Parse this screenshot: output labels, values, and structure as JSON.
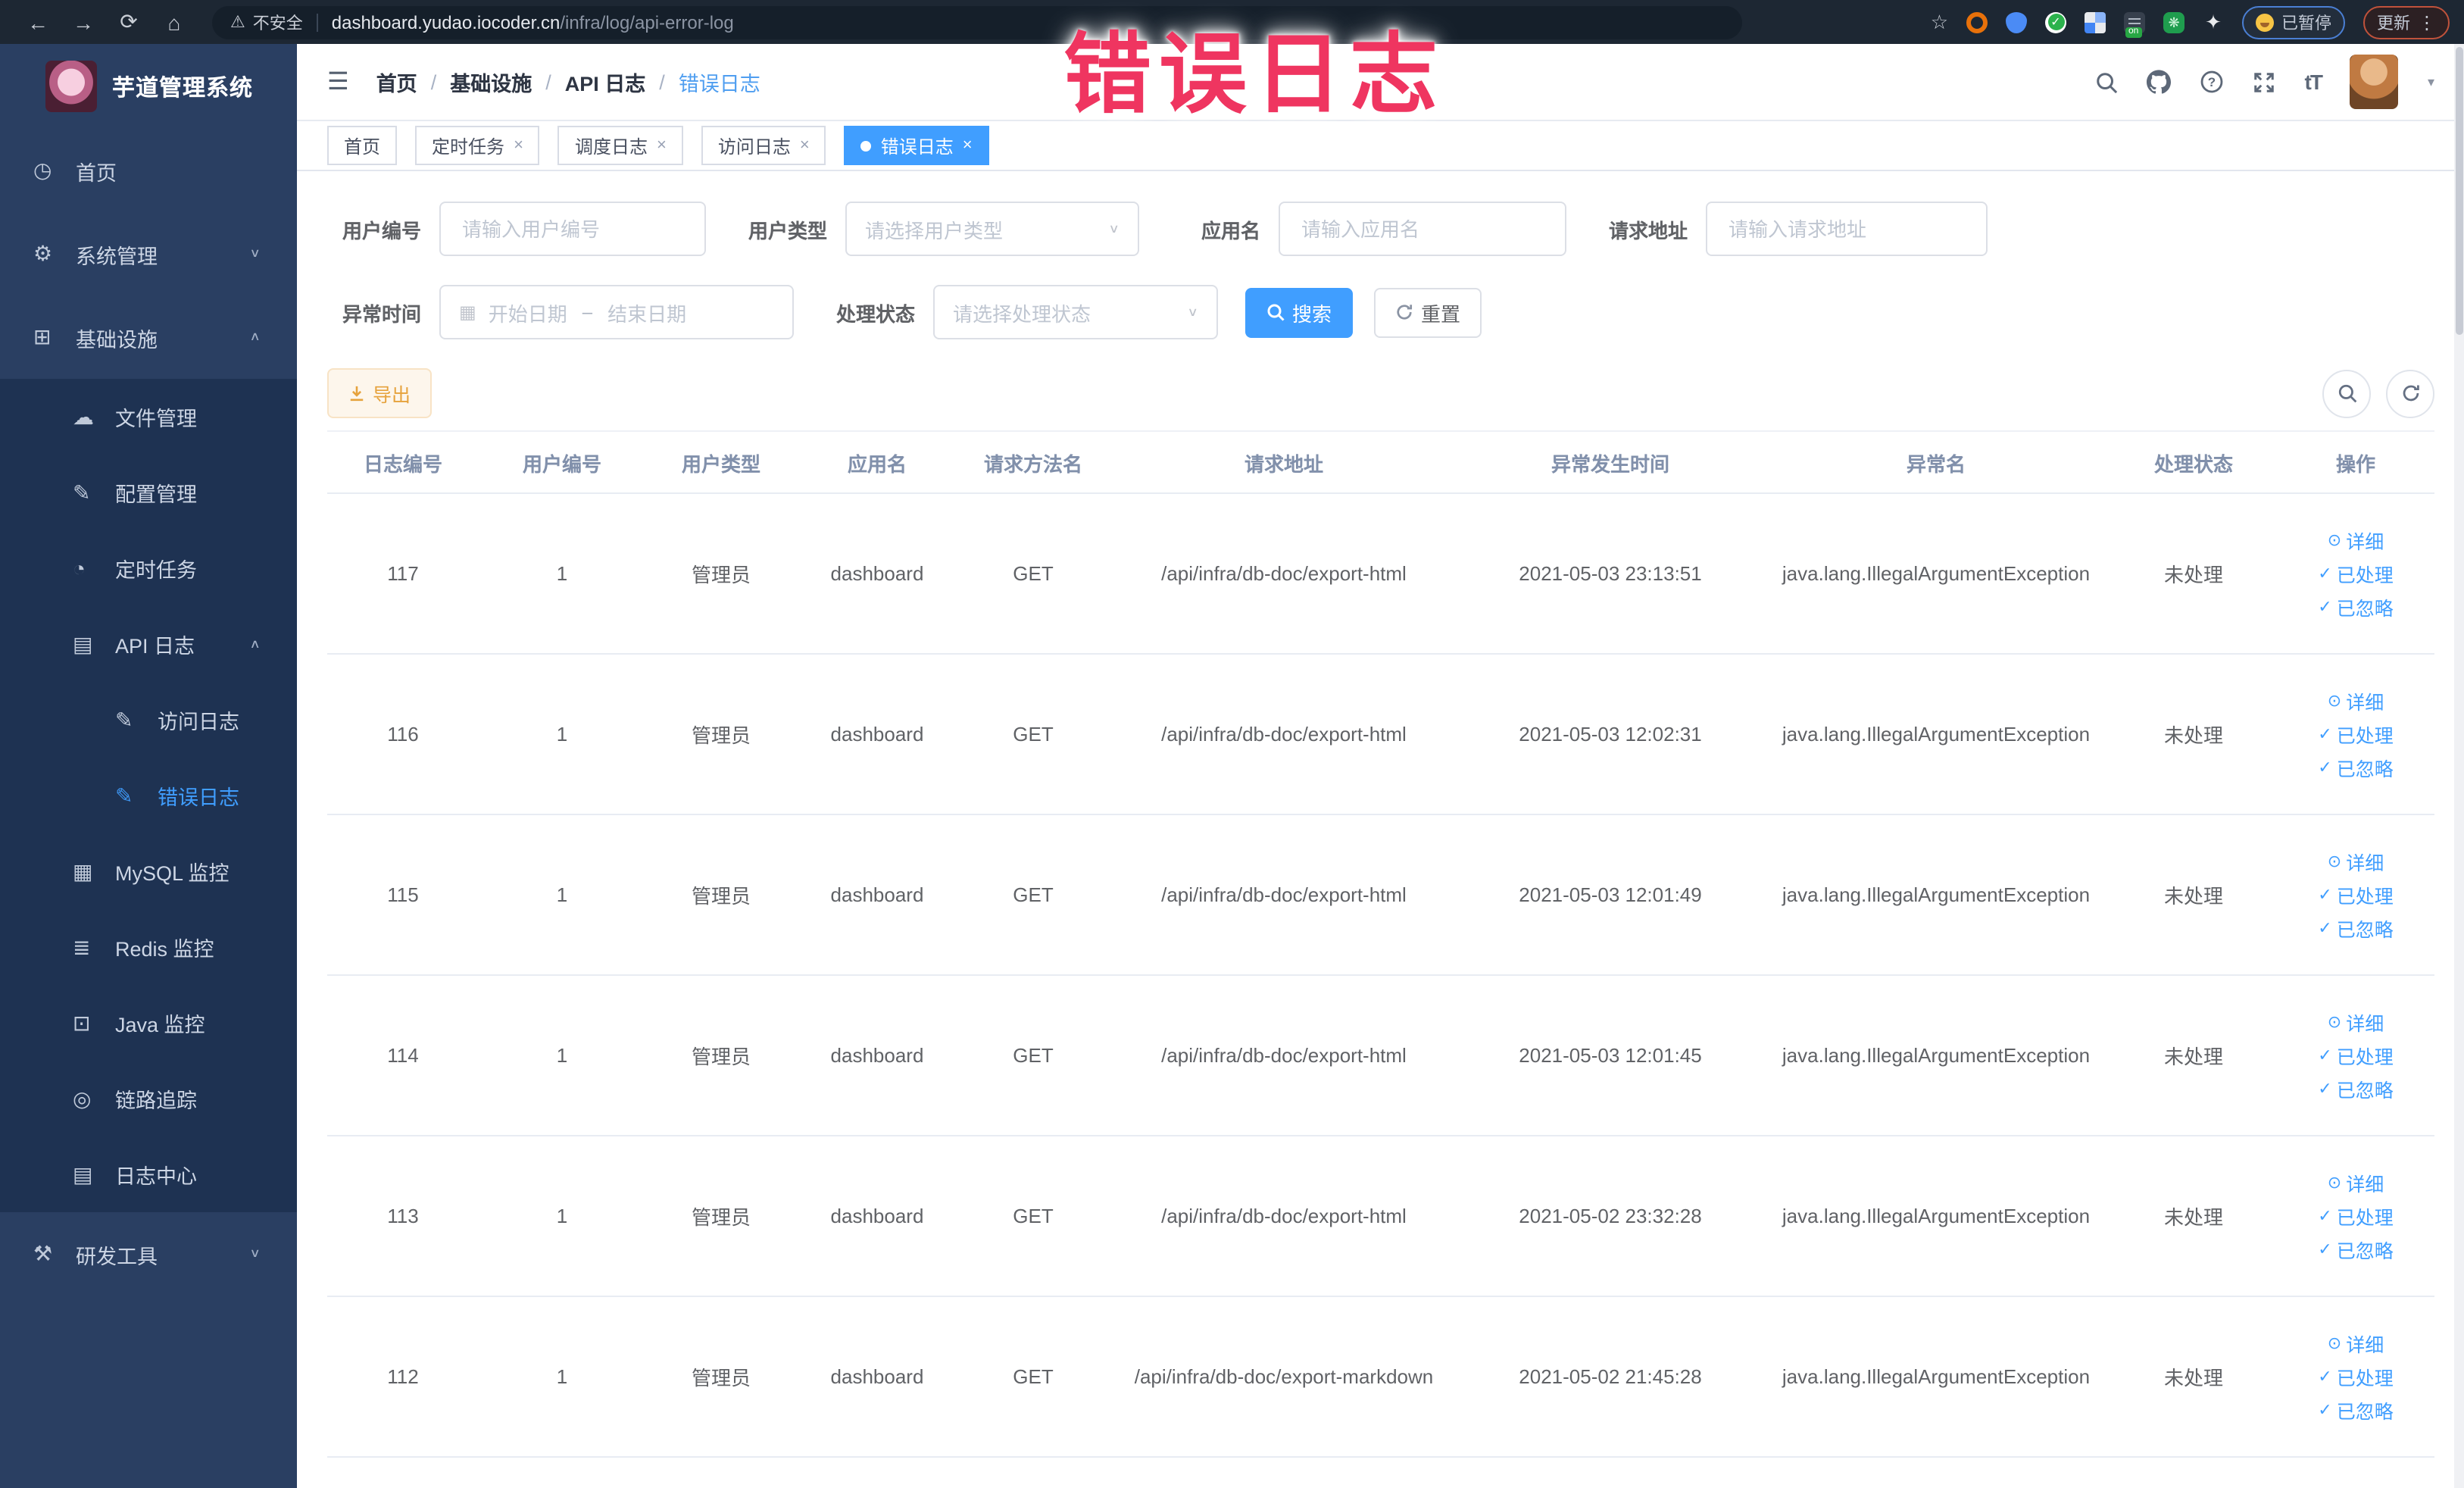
{
  "overlay": {
    "text": "错误日志"
  },
  "browser": {
    "security_label": "不安全",
    "url_host": "dashboard.yudao.iocoder.cn",
    "url_path": "/infra/log/api-error-log",
    "on_badge": "on",
    "paused_label": "已暂停",
    "update_label": "更新"
  },
  "sidebar": {
    "title": "芋道管理系统",
    "items": [
      {
        "name": "home",
        "icon": "dashboard-icon",
        "glyph": "◷",
        "label": "首页",
        "level": 0
      },
      {
        "name": "system",
        "icon": "gear-icon",
        "glyph": "⚙",
        "label": "系统管理",
        "level": 0,
        "arrow": "down"
      },
      {
        "name": "infra",
        "icon": "monitor-icon",
        "glyph": "⊞",
        "label": "基础设施",
        "level": 0,
        "arrow": "up"
      },
      {
        "name": "file-manage",
        "icon": "cloud-icon",
        "glyph": "☁",
        "label": "文件管理",
        "level": 1,
        "sub": true
      },
      {
        "name": "config-manage",
        "icon": "edit-icon",
        "glyph": "✎",
        "label": "配置管理",
        "level": 1,
        "sub": true
      },
      {
        "name": "scheduled-job",
        "icon": "clock-icon",
        "glyph": "◔",
        "label": "定时任务",
        "level": 1,
        "sub": true
      },
      {
        "name": "api-log",
        "icon": "document-icon",
        "glyph": "▤",
        "label": "API 日志",
        "level": 1,
        "arrow": "up",
        "sub": true
      },
      {
        "name": "access-log",
        "icon": "log-icon",
        "glyph": "✎",
        "label": "访问日志",
        "level": 2,
        "sub": true
      },
      {
        "name": "error-log",
        "icon": "log-icon",
        "glyph": "✎",
        "label": "错误日志",
        "level": 2,
        "sub": true,
        "active": true
      },
      {
        "name": "mysql-monitor",
        "icon": "database-icon",
        "glyph": "▦",
        "label": "MySQL 监控",
        "level": 1,
        "sub": true
      },
      {
        "name": "redis-monitor",
        "icon": "layers-icon",
        "glyph": "≣",
        "label": "Redis 监控",
        "level": 1,
        "sub": true
      },
      {
        "name": "java-monitor",
        "icon": "screen-icon",
        "glyph": "⊡",
        "label": "Java 监控",
        "level": 1,
        "sub": true
      },
      {
        "name": "trace",
        "icon": "eye-icon",
        "glyph": "◎",
        "label": "链路追踪",
        "level": 1,
        "sub": true
      },
      {
        "name": "log-center",
        "icon": "log-center-icon",
        "glyph": "▤",
        "label": "日志中心",
        "level": 1,
        "sub": true
      },
      {
        "name": "dev-tools",
        "icon": "toolbox-icon",
        "glyph": "⚒",
        "label": "研发工具",
        "level": 0,
        "arrow": "down"
      }
    ]
  },
  "navbar": {
    "breadcrumb": [
      {
        "label": "首页"
      },
      {
        "label": "基础设施"
      },
      {
        "label": "API 日志"
      },
      {
        "label": "错误日志",
        "active": true
      }
    ],
    "font_size_icon": "tT"
  },
  "tabs": [
    {
      "label": "首页"
    },
    {
      "label": "定时任务",
      "closable": true
    },
    {
      "label": "调度日志",
      "closable": true
    },
    {
      "label": "访问日志",
      "closable": true
    },
    {
      "label": "错误日志",
      "closable": true,
      "active": true
    }
  ],
  "filters": {
    "user_id": {
      "label": "用户编号",
      "placeholder": "请输入用户编号"
    },
    "user_type": {
      "label": "用户类型",
      "placeholder": "请选择用户类型"
    },
    "app_name": {
      "label": "应用名",
      "placeholder": "请输入应用名"
    },
    "request_url": {
      "label": "请求地址",
      "placeholder": "请输入请求地址"
    },
    "exception_time": {
      "label": "异常时间",
      "start_placeholder": "开始日期",
      "separator": "–",
      "end_placeholder": "结束日期"
    },
    "process_status": {
      "label": "处理状态",
      "placeholder": "请选择处理状态"
    },
    "search_label": "搜索",
    "reset_label": "重置"
  },
  "toolbar": {
    "export_label": "导出"
  },
  "table": {
    "columns": [
      "日志编号",
      "用户编号",
      "用户类型",
      "应用名",
      "请求方法名",
      "请求地址",
      "异常发生时间",
      "异常名",
      "处理状态",
      "操作"
    ],
    "row_actions": [
      {
        "label": "详细",
        "glyph": "⊙",
        "icon": "view-icon"
      },
      {
        "label": "已处理",
        "glyph": "✓",
        "icon": "check-icon"
      },
      {
        "label": "已忽略",
        "glyph": "✓",
        "icon": "check-icon"
      }
    ],
    "rows": [
      {
        "id": "117",
        "user_id": "1",
        "user_type": "管理员",
        "app_name": "dashboard",
        "method": "GET",
        "url": "/api/infra/db-doc/export-html",
        "time": "2021-05-03 23:13:51",
        "exception": "java.lang.IllegalArgumentException",
        "status": "未处理"
      },
      {
        "id": "116",
        "user_id": "1",
        "user_type": "管理员",
        "app_name": "dashboard",
        "method": "GET",
        "url": "/api/infra/db-doc/export-html",
        "time": "2021-05-03 12:02:31",
        "exception": "java.lang.IllegalArgumentException",
        "status": "未处理"
      },
      {
        "id": "115",
        "user_id": "1",
        "user_type": "管理员",
        "app_name": "dashboard",
        "method": "GET",
        "url": "/api/infra/db-doc/export-html",
        "time": "2021-05-03 12:01:49",
        "exception": "java.lang.IllegalArgumentException",
        "status": "未处理"
      },
      {
        "id": "114",
        "user_id": "1",
        "user_type": "管理员",
        "app_name": "dashboard",
        "method": "GET",
        "url": "/api/infra/db-doc/export-html",
        "time": "2021-05-03 12:01:45",
        "exception": "java.lang.IllegalArgumentException",
        "status": "未处理"
      },
      {
        "id": "113",
        "user_id": "1",
        "user_type": "管理员",
        "app_name": "dashboard",
        "method": "GET",
        "url": "/api/infra/db-doc/export-html",
        "time": "2021-05-02 23:32:28",
        "exception": "java.lang.IllegalArgumentException",
        "status": "未处理"
      },
      {
        "id": "112",
        "user_id": "1",
        "user_type": "管理员",
        "app_name": "dashboard",
        "method": "GET",
        "url": "/api/infra/db-doc/export-markdown",
        "time": "2021-05-02 21:45:28",
        "exception": "java.lang.IllegalArgumentException",
        "status": "未处理"
      }
    ]
  },
  "colors": {
    "primary": "#409eff",
    "warning": "#e6a23c",
    "overlay": "#ef3560",
    "sidebar_bg": "#2a3f62",
    "submenu_bg": "#1e3252"
  }
}
